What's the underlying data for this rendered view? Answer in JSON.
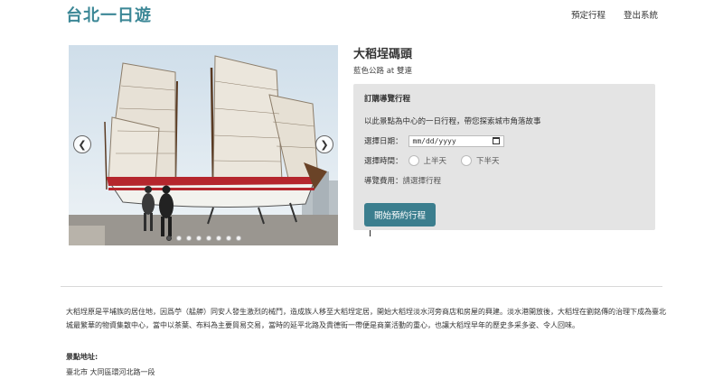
{
  "header": {
    "logo": "台北一日遊",
    "nav": [
      "預定行程",
      "登出系統"
    ]
  },
  "place": {
    "title": "大稻埕碼頭",
    "subtitle": "藍色公路 at 雙連"
  },
  "booking": {
    "heading": "訂購導覽行程",
    "description": "以此景點為中心的一日行程，帶您探索城市角落故事",
    "date_label": "選擇日期：",
    "date_placeholder": "mm/dd/yyyy",
    "time_label": "選擇時間：",
    "time_options": [
      "上半天",
      "下半天"
    ],
    "fee_label": "導覽費用：",
    "fee_value": "請選擇行程",
    "submit_label": "開始預約行程"
  },
  "carousel": {
    "slide_count": 8,
    "active_index": 0,
    "prev_icon": "chevron-left-icon",
    "next_icon": "chevron-right-icon"
  },
  "description": "大稻埕原是平埔族的居住地，因爲苧（艋舺）同安人發生激烈的械鬥，造成族人移至大稻埕定居，開始大稻埕淡水河旁商店和房屋的興建。淡水港開放後，大稻埕在劉銘傳的治理下成為臺北城最繁華的物資集散中心，當中以茶葉、布料為主要貿易交易，當時的延平北路及貴德街一帶便是商業活動的重心，也讓大稻埕早年的歷史多采多姿、令人回味。",
  "address": {
    "label": "景點地址:",
    "value": "臺北市 大同區環河北路一段"
  },
  "colors": {
    "brand": "#3b8796",
    "button": "#3b7e8e",
    "panel": "#e4e4e4"
  }
}
